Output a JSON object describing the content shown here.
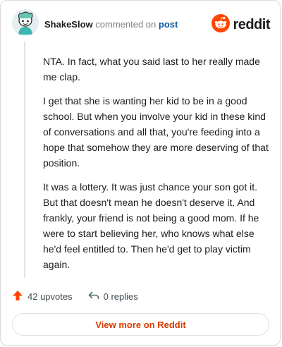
{
  "header": {
    "username": "ShakeSlow",
    "commented_on": "commented on",
    "post_link": "post",
    "brand": "reddit"
  },
  "comment": {
    "paragraphs": [
      "NTA. In fact, what you said last to her really made me clap.",
      "I get that she is wanting her kid to be in a good school. But when you involve your kid in these kind of conversations and all that, you're feeding into a hope that somehow they are more deserving of that position.",
      "It was a lottery. It was just chance your son got it. But that doesn't mean he doesn't deserve it. And frankly, your friend is not being a good mom. If he were to start believing her, who knows what else he'd feel entitled to. Then he'd get to play victim again."
    ]
  },
  "actions": {
    "upvotes": "42 upvotes",
    "replies": "0 replies"
  },
  "footer": {
    "view_more": "View more on Reddit"
  },
  "colors": {
    "brand_orange": "#ff4500",
    "link_blue": "#0b57a4",
    "view_more_text": "#d93a00",
    "upvote_arrow": "#ff4500"
  },
  "icons": {
    "avatar": "snoo-avatar-icon",
    "brand": "reddit-logo-icon",
    "upvote": "upvote-arrow-icon",
    "reply": "reply-arrow-icon"
  }
}
